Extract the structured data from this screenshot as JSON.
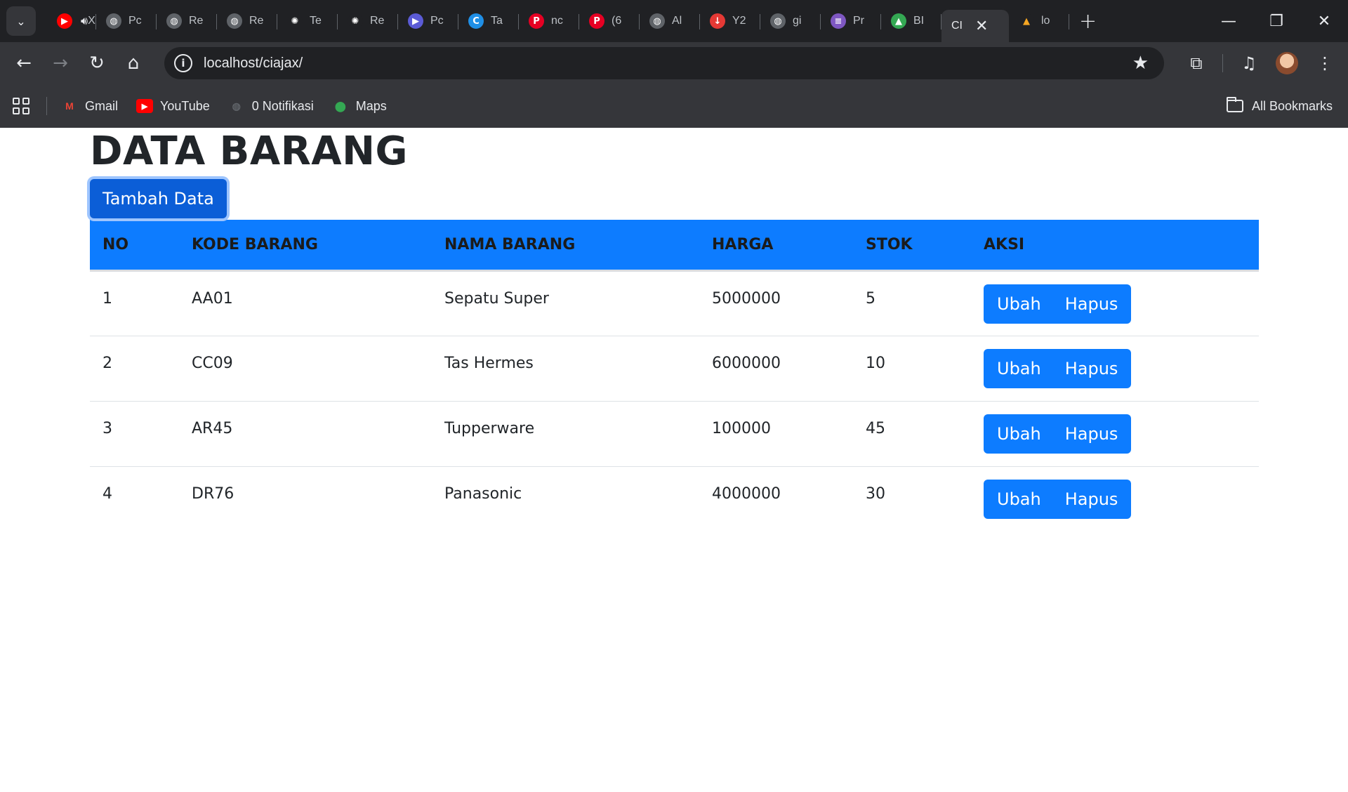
{
  "browser": {
    "tabs": [
      {
        "label": "XI",
        "icon": "youtube-icon",
        "color": "#ff0000",
        "glyph": "▶"
      },
      {
        "label": "Pc",
        "icon": "globe-icon",
        "color": "#5f6368",
        "glyph": "◍"
      },
      {
        "label": "Re",
        "icon": "globe-icon",
        "color": "#5f6368",
        "glyph": "◍"
      },
      {
        "label": "Re",
        "icon": "globe-icon",
        "color": "#5f6368",
        "glyph": "◍"
      },
      {
        "label": "Te",
        "icon": "openai-icon",
        "color": "#202124",
        "glyph": "✺"
      },
      {
        "label": "Re",
        "icon": "openai-icon",
        "color": "#202124",
        "glyph": "✺"
      },
      {
        "label": "Pc",
        "icon": "video-icon",
        "color": "#5b5bd6",
        "glyph": "▶"
      },
      {
        "label": "Ta",
        "icon": "canva-icon",
        "color": "#1f8fe6",
        "glyph": "C"
      },
      {
        "label": "nc",
        "icon": "pinterest-icon",
        "color": "#e60023",
        "glyph": "P"
      },
      {
        "label": "(6",
        "icon": "pinterest-icon",
        "color": "#e60023",
        "glyph": "P"
      },
      {
        "label": "Al",
        "icon": "globe-icon",
        "color": "#5f6368",
        "glyph": "◍"
      },
      {
        "label": "Y2",
        "icon": "download-icon",
        "color": "#e53935",
        "glyph": "↓"
      },
      {
        "label": "gi",
        "icon": "globe-icon",
        "color": "#5f6368",
        "glyph": "◍"
      },
      {
        "label": "Pr",
        "icon": "list-icon",
        "color": "#7e57c2",
        "glyph": "≡"
      },
      {
        "label": "BI",
        "icon": "drive-icon",
        "color": "#34a853",
        "glyph": "▲"
      }
    ],
    "active_tab": {
      "label": "CI"
    },
    "last_tab": {
      "label": "lo"
    },
    "url": "localhost/ciajax/",
    "bookmarks": [
      {
        "label": "Gmail",
        "icon": "gmail-icon",
        "color": "#ea4335",
        "glyph": "M"
      },
      {
        "label": "YouTube",
        "icon": "youtube-icon",
        "color": "#ff0000",
        "glyph": "▶"
      },
      {
        "label": "0 Notifikasi",
        "icon": "globe-icon",
        "color": "#5f6368",
        "glyph": "◍"
      },
      {
        "label": "Maps",
        "icon": "maps-icon",
        "color": "#34a853",
        "glyph": "⬤"
      }
    ],
    "all_bookmarks": "All Bookmarks"
  },
  "page": {
    "title": "DATA BARANG",
    "add_button": "Tambah Data",
    "headers": {
      "no": "NO",
      "kode": "KODE BARANG",
      "nama": "NAMA BARANG",
      "harga": "HARGA",
      "stok": "STOK",
      "aksi": "AKSI"
    },
    "rows": [
      {
        "no": "1",
        "kode": "AA01",
        "nama": "Sepatu Super",
        "harga": "5000000",
        "stok": "5",
        "edit": "Ubah",
        "delete": "Hapus"
      },
      {
        "no": "2",
        "kode": "CC09",
        "nama": "Tas Hermes",
        "harga": "6000000",
        "stok": "10",
        "edit": "Ubah",
        "delete": "Hapus"
      },
      {
        "no": "3",
        "kode": "AR45",
        "nama": "Tupperware",
        "harga": "100000",
        "stok": "45",
        "edit": "Ubah",
        "delete": "Hapus"
      },
      {
        "no": "4",
        "kode": "DR76",
        "nama": "Panasonic",
        "harga": "4000000",
        "stok": "30",
        "edit": "Ubah",
        "delete": "Hapus"
      }
    ],
    "colors": {
      "primary": "#0d7cff",
      "add_button": "#0b5ed7"
    }
  }
}
